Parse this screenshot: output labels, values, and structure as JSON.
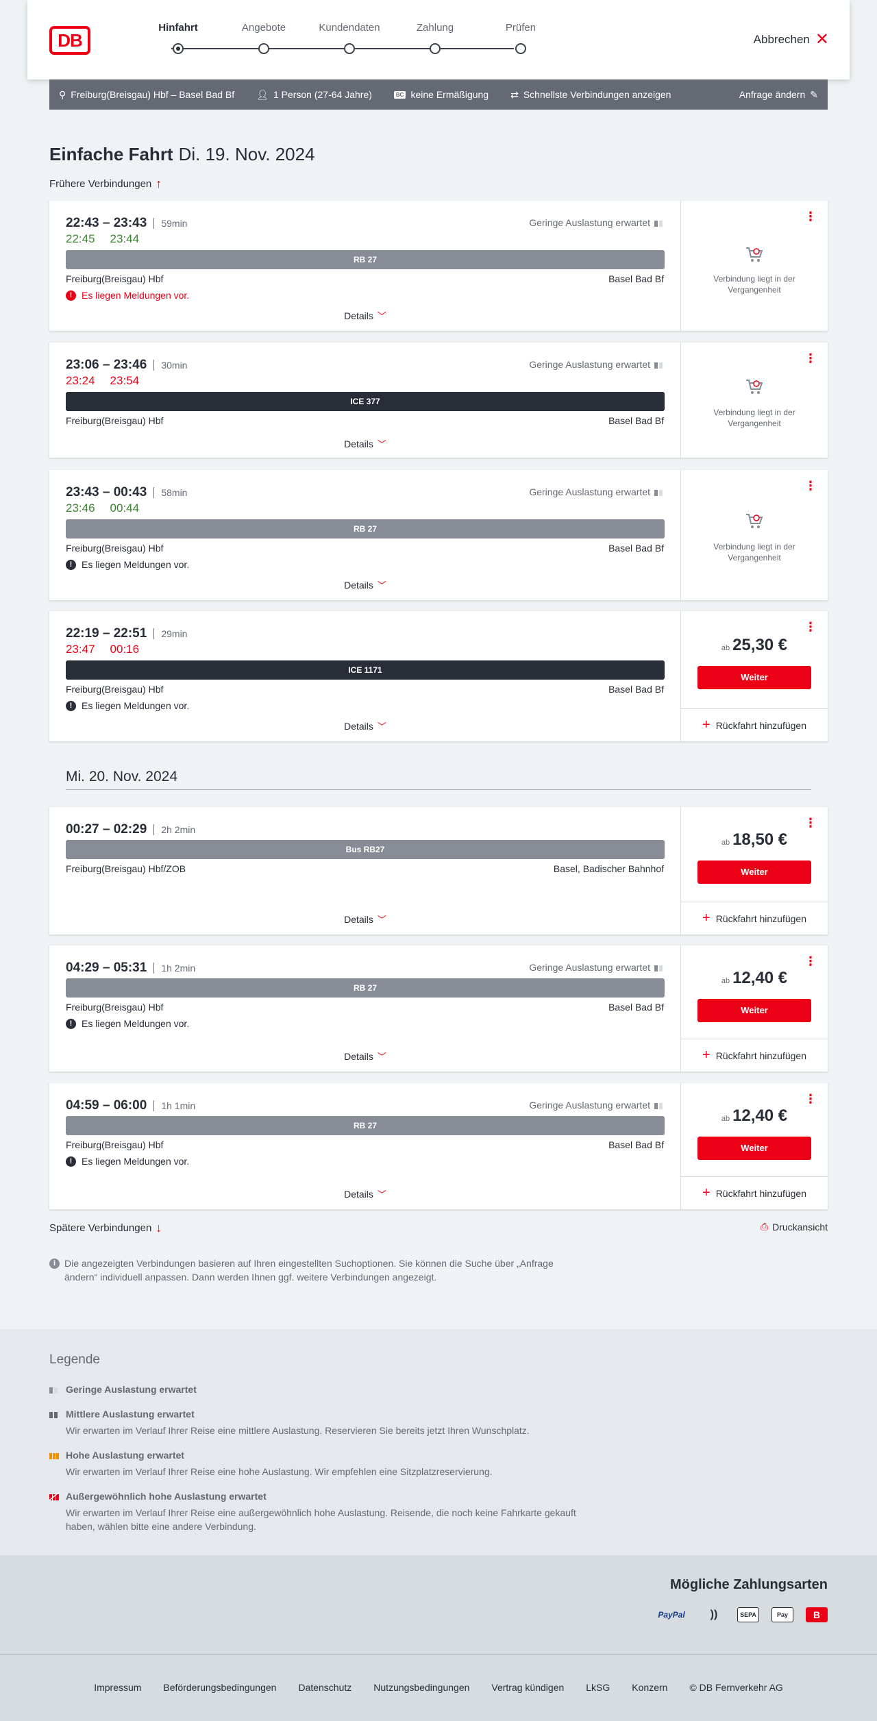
{
  "header": {
    "steps": [
      "Hinfahrt",
      "Angebote",
      "Kundendaten",
      "Zahlung",
      "Prüfen"
    ],
    "logo_text": "DB",
    "cancel_label": "Abbrechen"
  },
  "summary": {
    "route": "Freiburg(Breisgau) Hbf – Basel Bad Bf",
    "passengers": "1 Person (27-64 Jahre)",
    "discount_badge": "BC",
    "discount": "keine Ermäßigung",
    "fastest": "Schnellste Verbindungen anzeigen",
    "edit": "Anfrage ändern"
  },
  "title": {
    "trip": "Einfache Fahrt",
    "date": "Di. 19. Nov. 2024"
  },
  "earlier_label": "Frühere Verbindungen",
  "later_label": "Spätere Verbindungen",
  "print_label": "Druckansicht",
  "date_separator": "Mi. 20. Nov. 2024",
  "common": {
    "load_label": "Geringe Auslastung erwartet",
    "details": "Details",
    "message": "Es liegen Meldungen vor.",
    "past": [
      "Verbindung liegt in der",
      "Vergangenheit"
    ],
    "ab": "ab",
    "weiter": "Weiter",
    "return": "Rückfahrt hinzufügen"
  },
  "connections": [
    {
      "times": "22:43 – 23:43",
      "duration": "59min",
      "rt_dep": "22:45",
      "rt_arr": "23:44",
      "rt_color": "green",
      "train": "RB 27",
      "from": "Freiburg(Breisgau) Hbf",
      "to": "Basel Bad Bf"
    },
    {
      "times": "23:06 – 23:46",
      "duration": "30min",
      "rt_dep": "23:24",
      "rt_arr": "23:54",
      "rt_color": "red",
      "train": "ICE 377",
      "from": "Freiburg(Breisgau) Hbf",
      "to": "Basel Bad Bf"
    },
    {
      "times": "23:43 – 00:43",
      "duration": "58min",
      "rt_dep": "23:46",
      "rt_arr": "00:44",
      "rt_color": "green",
      "train": "RB 27",
      "from": "Freiburg(Breisgau) Hbf",
      "to": "Basel Bad Bf"
    },
    {
      "times": "22:19 – 22:51",
      "duration": "29min",
      "rt_dep": "23:47",
      "rt_arr": "00:16",
      "rt_color": "red",
      "train": "ICE 1171",
      "from": "Freiburg(Breisgau) Hbf",
      "to": "Basel Bad Bf",
      "price": "25,30 €"
    },
    {
      "times": "00:27 – 02:29",
      "duration": "2h 2min",
      "train": "Bus RB27",
      "from": "Freiburg(Breisgau) Hbf/ZOB",
      "to": "Basel, Badischer Bahnhof",
      "price": "18,50 €"
    },
    {
      "times": "04:29 – 05:31",
      "duration": "1h 2min",
      "train": "RB 27",
      "from": "Freiburg(Breisgau) Hbf",
      "to": "Basel Bad Bf",
      "price": "12,40 €"
    },
    {
      "times": "04:59 – 06:00",
      "duration": "1h 1min",
      "train": "RB 27",
      "from": "Freiburg(Breisgau) Hbf",
      "to": "Basel Bad Bf",
      "price": "12,40 €"
    }
  ],
  "note": "Die angezeigten Verbindungen basieren auf Ihren eingestellten Suchoptionen. Sie können die Suche über „Anfrage ändern“ individuell anpassen. Dann werden Ihnen ggf. weitere Verbindungen angezeigt.",
  "legend": {
    "title": "Legende",
    "items": [
      {
        "title": "Geringe Auslastung erwartet",
        "desc": "",
        "color": "#878c96"
      },
      {
        "title": "Mittlere Auslastung erwartet",
        "desc": "Wir erwarten im Verlauf Ihrer Reise eine mittlere Auslastung. Reservieren Sie bereits jetzt Ihren Wunschplatz.",
        "color": "#646973"
      },
      {
        "title": "Hohe Auslastung erwartet",
        "desc": "Wir erwarten im Verlauf Ihrer Reise eine hohe Auslastung. Wir empfehlen eine Sitzplatzreservierung.",
        "color": "#f39200"
      },
      {
        "title": "Außergewöhnlich hohe Auslastung erwartet",
        "desc": "Wir erwarten im Verlauf Ihrer Reise eine außergewöhnlich hohe Auslastung. Reisende, die noch keine Fahrkarte gekauft haben, wählen bitte eine andere Verbindung.",
        "color": "#ec0016"
      }
    ]
  },
  "payment": {
    "title": "Mögliche Zahlungsarten",
    "methods": [
      "PayPal",
      "))",
      "SEPA",
      "Pay",
      "B"
    ]
  },
  "footer": [
    "Impressum",
    "Beförderungsbedingungen",
    "Datenschutz",
    "Nutzungsbedingungen",
    "Vertrag kündigen",
    "LkSG",
    "Konzern",
    "© DB Fernverkehr AG"
  ],
  "colors": {
    "brand_red": "#ec0016",
    "delay_green": "#408335",
    "bar_gray": "#878c96",
    "bar_dark": "#282d37"
  }
}
